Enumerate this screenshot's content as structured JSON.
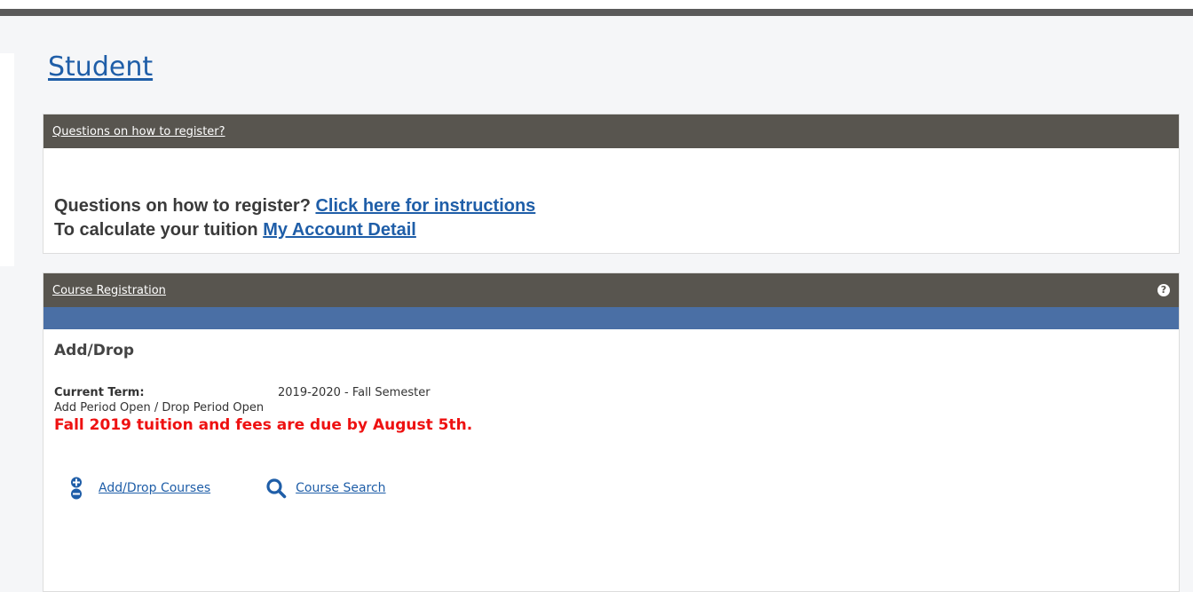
{
  "page": {
    "title": "Student"
  },
  "questions_panel": {
    "header": "Questions on how to register?",
    "line1_text": "Questions on how to register? ",
    "line1_link": "Click here for instructions",
    "line2_text": "To calculate your tuition ",
    "line2_link": "My Account Detail"
  },
  "course_panel": {
    "header": "Course Registration",
    "help_icon": "?",
    "section_title": "Add/Drop",
    "current_term_label": "Current Term:",
    "current_term_value": "2019-2020 - Fall Semester",
    "period_status": "Add Period Open / Drop Period Open",
    "due_notice": "Fall 2019 tuition and fees are due by August 5th.",
    "actions": [
      {
        "label": "Add/Drop Courses",
        "icon": "plus-minus-icon"
      },
      {
        "label": "Course Search",
        "icon": "search-icon"
      }
    ]
  },
  "colors": {
    "link": "#1f5ea8",
    "header_bg": "#58554f",
    "band": "#4a6fa5",
    "alert": "#ee1111"
  }
}
